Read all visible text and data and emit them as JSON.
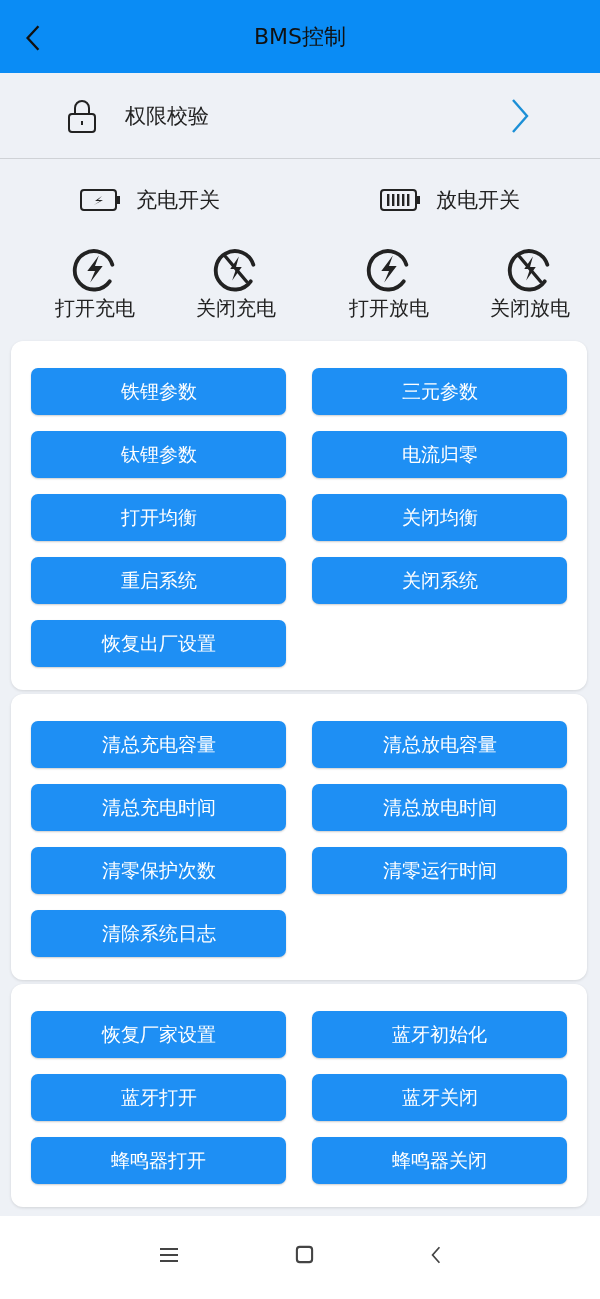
{
  "header": {
    "title": "BMS控制"
  },
  "permission": {
    "label": "权限校验"
  },
  "switch_groups": [
    {
      "label": "充电开关",
      "kind": "charge"
    },
    {
      "label": "放电开关",
      "kind": "discharge"
    }
  ],
  "actions": [
    {
      "label": "打开充电",
      "kind": "on"
    },
    {
      "label": "关闭充电",
      "kind": "off"
    },
    {
      "label": "打开放电",
      "kind": "on"
    },
    {
      "label": "关闭放电",
      "kind": "off"
    }
  ],
  "panels": [
    {
      "buttons": [
        "铁锂参数",
        "三元参数",
        "钛锂参数",
        "电流归零",
        "打开均衡",
        "关闭均衡",
        "重启系统",
        "关闭系统",
        "恢复出厂设置"
      ]
    },
    {
      "buttons": [
        "清总充电容量",
        "清总放电容量",
        "清总充电时间",
        "清总放电时间",
        "清零保护次数",
        "清零运行时间",
        "清除系统日志"
      ]
    },
    {
      "buttons": [
        "恢复厂家设置",
        "蓝牙初始化",
        "蓝牙打开",
        "蓝牙关闭",
        "蜂鸣器打开",
        "蜂鸣器关闭"
      ]
    }
  ]
}
